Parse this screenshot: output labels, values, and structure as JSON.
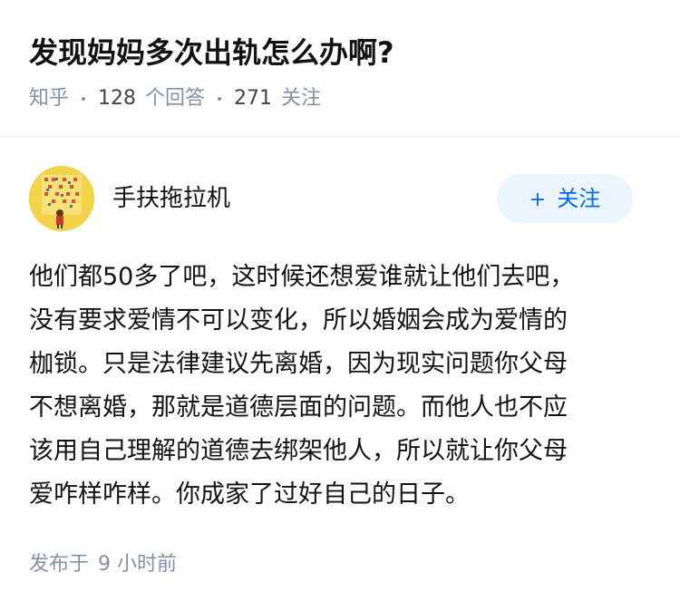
{
  "question": {
    "title": "发现妈妈多次出轨怎么办啊?",
    "source": "知乎",
    "answer_count": "128",
    "answer_label": "个回答",
    "follower_count": "271",
    "follower_label": "关注"
  },
  "author": {
    "name": "手扶拖拉机",
    "follow_label": "关注",
    "follow_icon": "plus-icon"
  },
  "answer": {
    "lines": [
      "他们都50多了吧，这时候还想爱谁就让他们去吧，",
      "没有要求爱情不可以变化，所以婚姻会成为爱情的",
      "枷锁。只是法律建议先离婚，因为现实问题你父母",
      "不想离婚，那就是道德层面的问题。而他人也不应",
      "该用自己理解的道德去绑架他人，所以就让你父母",
      "爱咋样咋样。你成家了过好自己的日子。"
    ],
    "publish_label": "发布于",
    "publish_time": "9 小时前"
  },
  "colors": {
    "accent": "#0066ff",
    "meta": "#8590a6",
    "follow_bg": "#ebf5ff",
    "avatar_bg": "#f2d34a"
  }
}
